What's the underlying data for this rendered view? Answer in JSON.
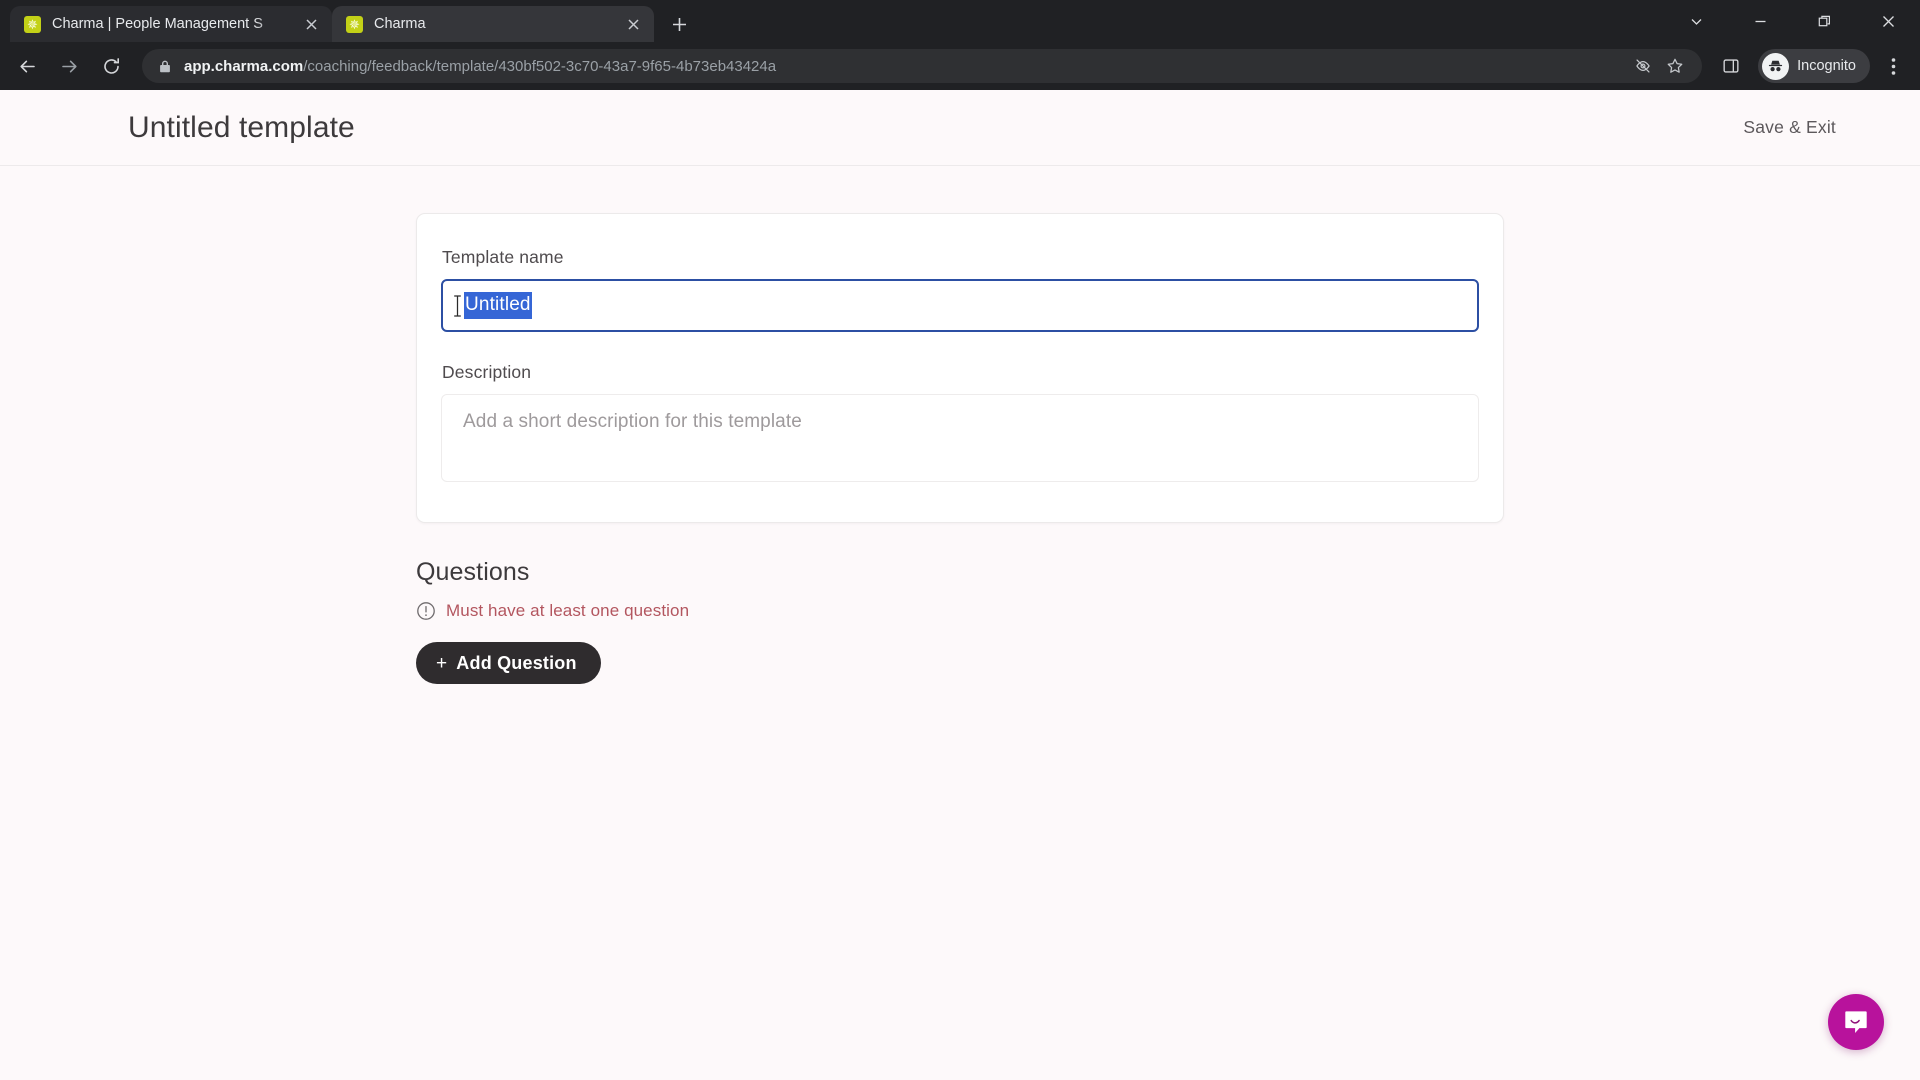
{
  "browser": {
    "tabs": [
      {
        "title": "Charma | People Management S",
        "favicon": "charma-star-favicon",
        "active": false
      },
      {
        "title": "Charma",
        "favicon": "charma-star-favicon",
        "active": true
      }
    ],
    "new_tab_label": "+",
    "window_controls": {
      "tab_search": "tab-search-chevron",
      "minimize": "minimize",
      "maximize": "maximize",
      "close": "close"
    },
    "nav": {
      "back": "back-arrow",
      "forward": "forward-arrow",
      "reload": "reload"
    },
    "omnibox": {
      "site_icon": "lock-icon",
      "host": "app.charma.com",
      "path": "/coaching/feedback/template/430bf502-3c70-43a7-9f65-4b73eb43424a",
      "tracking_protection": "eye-slash-icon",
      "bookmark": "star-icon"
    },
    "side_panel": "side-panel-icon",
    "profile": {
      "label": "Incognito",
      "icon": "incognito-hat-icon"
    },
    "menu": "kebab-menu-icon"
  },
  "page": {
    "title": "Untitled template",
    "save_exit_label": "Save & Exit",
    "form": {
      "name_label": "Template name",
      "name_value": "Untitled",
      "name_selected": true,
      "description_label": "Description",
      "description_value": "",
      "description_placeholder": "Add a short description for this template"
    },
    "questions": {
      "heading": "Questions",
      "error_text": "Must have at least one question",
      "error_icon": "alert-circle-icon",
      "add_button_label": "Add Question",
      "add_button_plus": "+"
    },
    "support": {
      "launcher_icon": "intercom-chat-icon"
    },
    "colors": {
      "page_background": "#fdf9fa",
      "card_background": "#ffffff",
      "focus_border": "#2c4fa3",
      "selection_highlight": "#3566d6",
      "error_text": "#b3565f",
      "button_background": "#2f2c2e",
      "intercom_background": "#b8129c",
      "favicon": "#c3d117"
    }
  }
}
